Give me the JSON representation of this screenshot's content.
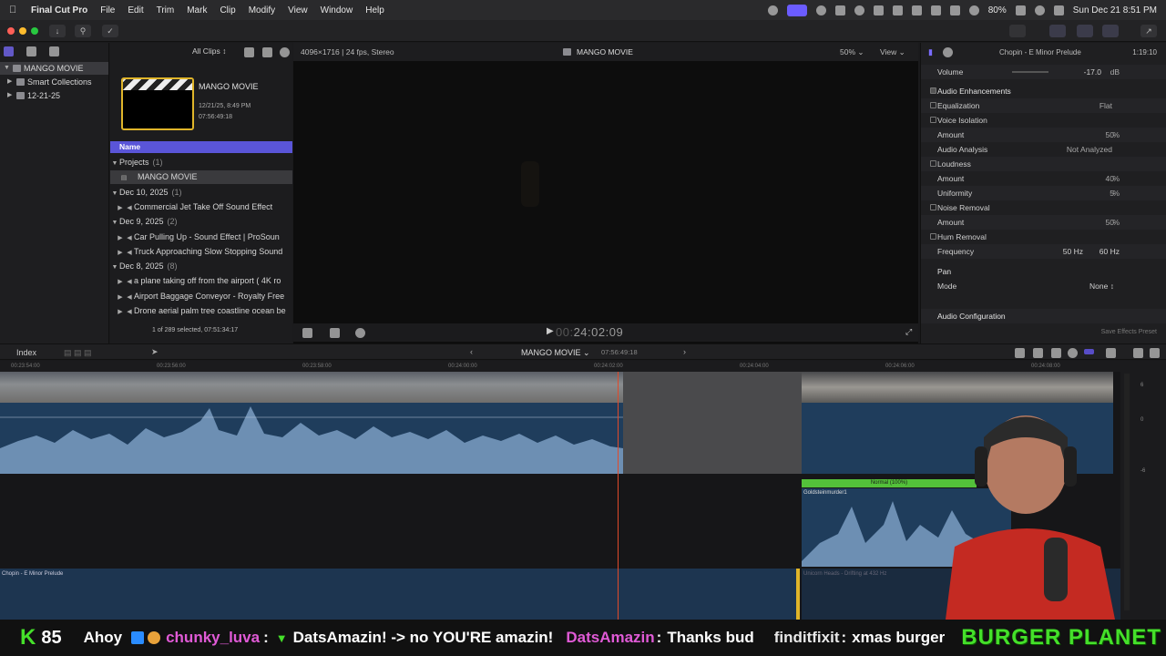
{
  "menubar": {
    "app_name": "Final Cut Pro",
    "items": [
      "File",
      "Edit",
      "Trim",
      "Mark",
      "Clip",
      "Modify",
      "View",
      "Window",
      "Help"
    ],
    "battery": "80%",
    "datetime": "Sun Dec 21  8:51 PM"
  },
  "browser": {
    "filter": "All Clips",
    "library": "MANGO MOVIE",
    "smart_collections": "Smart Collections",
    "event": "12-21-25",
    "thumb_title": "MANGO MOVIE",
    "thumb_date": "12/21/25, 8:49 PM",
    "thumb_duration": "07:56:49:18",
    "name_header": "Name",
    "rows": [
      {
        "type": "group",
        "label": "Projects",
        "count": "(1)"
      },
      {
        "type": "item",
        "label": "MANGO MOVIE",
        "selected": true
      },
      {
        "type": "group",
        "label": "Dec 10, 2025",
        "count": "(1)"
      },
      {
        "type": "item",
        "label": "Commercial Jet Take Off Sound Effect"
      },
      {
        "type": "group",
        "label": "Dec 9, 2025",
        "count": "(2)"
      },
      {
        "type": "item",
        "label": "Car Pulling Up - Sound Effect  |  ProSoun"
      },
      {
        "type": "item",
        "label": "Truck Approaching Slow Stopping Sound"
      },
      {
        "type": "group",
        "label": "Dec 8, 2025",
        "count": "(8)"
      },
      {
        "type": "item",
        "label": "a plane taking off from the airport ( 4K ro"
      },
      {
        "type": "item",
        "label": "Airport Baggage Conveyor - Royalty Free"
      },
      {
        "type": "item",
        "label": "Drone aerial palm tree coastline ocean be"
      }
    ],
    "status": "1 of 289 selected, 07:51:34:17"
  },
  "viewer": {
    "format": "4096×1716 | 24 fps, Stereo",
    "title": "MANGO MOVIE",
    "zoom": "50%",
    "view_label": "View",
    "timecode_prefix": "00:",
    "timecode": "24:02:09"
  },
  "inspector": {
    "clip_name": "Chopin - E Minor Prelude",
    "duration": "1:19:10",
    "volume_label": "Volume",
    "volume_value": "-17.0",
    "volume_unit": "dB",
    "section_enh": "Audio Enhancements",
    "rows": [
      {
        "label": "Equalization",
        "check": true,
        "val": "Flat"
      },
      {
        "label": "Voice Isolation",
        "check": true,
        "val": ""
      },
      {
        "label": "Amount",
        "check": false,
        "val": "50",
        "unit": "%"
      },
      {
        "label": "Audio Analysis",
        "check": false,
        "val": "Not Analyzed"
      },
      {
        "label": "Loudness",
        "check": true,
        "val": ""
      },
      {
        "label": "Amount",
        "check": false,
        "val": "40",
        "unit": "%"
      },
      {
        "label": "Uniformity",
        "check": false,
        "val": "5",
        "unit": "%"
      },
      {
        "label": "Noise Removal",
        "check": true,
        "val": ""
      },
      {
        "label": "Amount",
        "check": false,
        "val": "50",
        "unit": "%"
      },
      {
        "label": "Hum Removal",
        "check": true,
        "val": ""
      },
      {
        "label": "Frequency",
        "check": false,
        "val": "50 Hz",
        "val2": "60 Hz"
      }
    ],
    "pan_label": "Pan",
    "mode_label": "Mode",
    "mode_value": "None",
    "audio_config": "Audio Configuration",
    "save_preset": "Save Effects Preset"
  },
  "timeline": {
    "index_label": "Index",
    "project": "MANGO MOVIE",
    "project_duration": "07:56:49:18",
    "ruler_ticks": [
      "00:23:54:00",
      "00:23:56:00",
      "00:23:58:00",
      "00:24:00:00",
      "00:24:02:00",
      "00:24:04:00",
      "00:24:06:00",
      "00:24:08:00"
    ],
    "music_clip": "Chopin - E Minor Prelude",
    "connected_audio": "Goldsteinmurder1",
    "retime_label": "Normal (100%)",
    "other_clip": "Unicorn Heads - Drifting at 432 Hz",
    "meter_labels": [
      "6",
      "0",
      "-6"
    ]
  },
  "ticker": {
    "bits": "85",
    "messages": [
      {
        "user": "Ahoy",
        "text": ""
      },
      {
        "user": "chunky_luva",
        "text": "DatsAmazin! -> no YOU'RE amazin!"
      },
      {
        "user": "DatsAmazin",
        "text": "Thanks bud"
      },
      {
        "user": "finditfixit",
        "text": "xmas burger"
      }
    ],
    "sponsor": "BURGER PLANET"
  },
  "colors": {
    "accent": "#5a55d8",
    "clip_yellow": "#e0b52a",
    "playhead": "#e04a2a",
    "audio_blue": "#1f3d5c",
    "retime_green": "#53c13a",
    "ticker_green": "#45e02a",
    "ticker_magenta": "#e05ad6"
  }
}
